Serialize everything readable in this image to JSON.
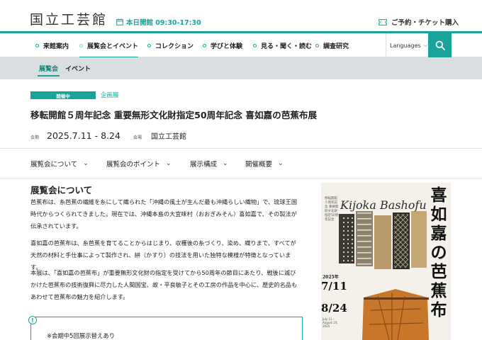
{
  "header": {
    "logo": "国立工芸館",
    "hours": "本日開館 09:30-17:30",
    "ticket": "ご予約・チケット購入"
  },
  "main_nav": {
    "items": [
      {
        "label": "来館案内"
      },
      {
        "label": "展覧会とイベント",
        "active": true
      },
      {
        "label": "コレクション"
      },
      {
        "label": "学びと体験"
      },
      {
        "label": "見る・聞く・読む"
      },
      {
        "label": "調査研究"
      }
    ],
    "language_label": "Languages"
  },
  "sub_nav": {
    "items": [
      {
        "label": "展覧会",
        "active": true
      },
      {
        "label": "イベント"
      }
    ]
  },
  "exhibition": {
    "status_badge": "開催中",
    "type_badge": "企画展",
    "title": "移転開館５周年記念 重要無形文化財指定50周年記念 喜如嘉の芭蕉布展",
    "date_label": "会期",
    "date_value": "2025.7.11 - 8.24",
    "venue_label": "会場",
    "venue_value": "国立工芸館"
  },
  "section_tabs": [
    {
      "label": "展覧会について"
    },
    {
      "label": "展覧会のポイント"
    },
    {
      "label": "展示構成"
    },
    {
      "label": "開催概要"
    }
  ],
  "content": {
    "heading": "展覧会について",
    "paragraphs": [
      "芭蕉布は、糸芭蕉の繊維を糸にして織られた「沖縄の風土が生んだ最も沖縄らしい織物」で、琉球王国時代からつくられてきました。現在では、沖縄本島の大宜味村（おおぎみそん）喜如嘉で、その製法が伝承されています。",
      "喜如嘉の芭蕉布は、糸芭蕉を育てることからはじまり、収穫後の糸づくり、染め、織りまで、すべてが天然の材料と手仕事によって製作され、絣（かすり）の技法を用いた独特な模様が特徴となっています。",
      "本展は、「喜如嘉の芭蕉布」が重要無形文化財の指定を受けてから50周年の節目にあたり、戦後に滅びかけた芭蕉布の技術復興に尽力した人間国宝、故・平良敏子とその工房の作品を中心に、歴史的名品もあわせて芭蕉布の魅力を紹介します。"
    ],
    "notice_icon": "!",
    "notice_text": "※会期中5回展示替えあり"
  },
  "poster": {
    "title_en": "Kijoka Bashofu",
    "title_jp": "喜如嘉の芭蕉布",
    "small_text": "移転開館５周年記念 重要無形文化財指定50周年記念",
    "year": "2025年",
    "start": "7/11",
    "end": "8/24",
    "detail": "July 11 – August 24, 2025",
    "colors": {
      "cloth_dark": "#3b3a32",
      "cloth_orange": "#c8772a",
      "cloth_tan": "#b89a6b"
    }
  },
  "colors": {
    "accent": "#1aa39a",
    "subnav_bg": "#d9dfe1"
  }
}
